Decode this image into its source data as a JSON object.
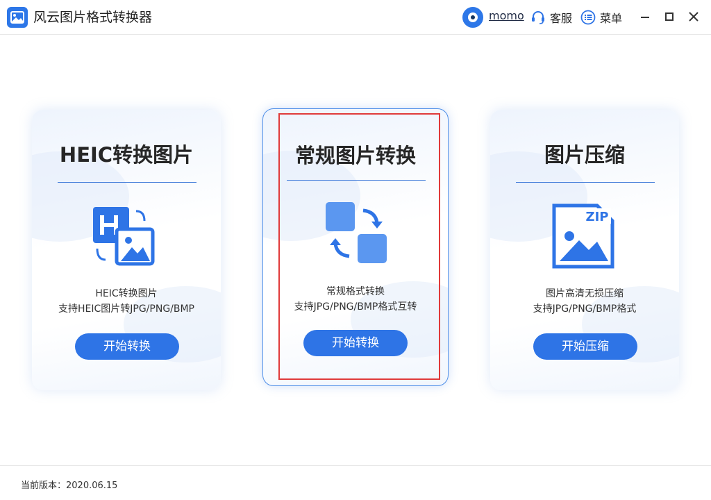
{
  "window": {
    "title": "风云图片格式转换器",
    "logo_icon": "image-icon"
  },
  "header": {
    "username": "momo",
    "service_label": "客服",
    "menu_label": "菜单",
    "icons": {
      "avatar": "avatar",
      "service": "headset-icon",
      "menu": "list-icon",
      "minimize": "minimize-icon",
      "maximize": "maximize-icon",
      "close": "close-icon"
    }
  },
  "cards": [
    {
      "title": "HEIC转换图片",
      "icon": "heic-image-icon",
      "desc_line1": "HEIC转换图片",
      "desc_line2": "支持HEIC图片转JPG/PNG/BMP",
      "button_label": "开始转换"
    },
    {
      "title": "常规图片转换",
      "icon": "convert-swap-icon",
      "desc_line1": "常规格式转换",
      "desc_line2": "支持JPG/PNG/BMP格式互转",
      "button_label": "开始转换",
      "selected": true
    },
    {
      "title": "图片压缩",
      "icon": "zip-image-icon",
      "zip_label": "ZIP",
      "desc_line1": "图片高清无损压缩",
      "desc_line2": "支持JPG/PNG/BMP格式",
      "button_label": "开始压缩"
    }
  ],
  "footer": {
    "version_text": "当前版本：2020.06.15"
  },
  "colors": {
    "accent": "#2e74e6",
    "highlight": "#e03a3a",
    "icon_light": "#5b97f0"
  }
}
